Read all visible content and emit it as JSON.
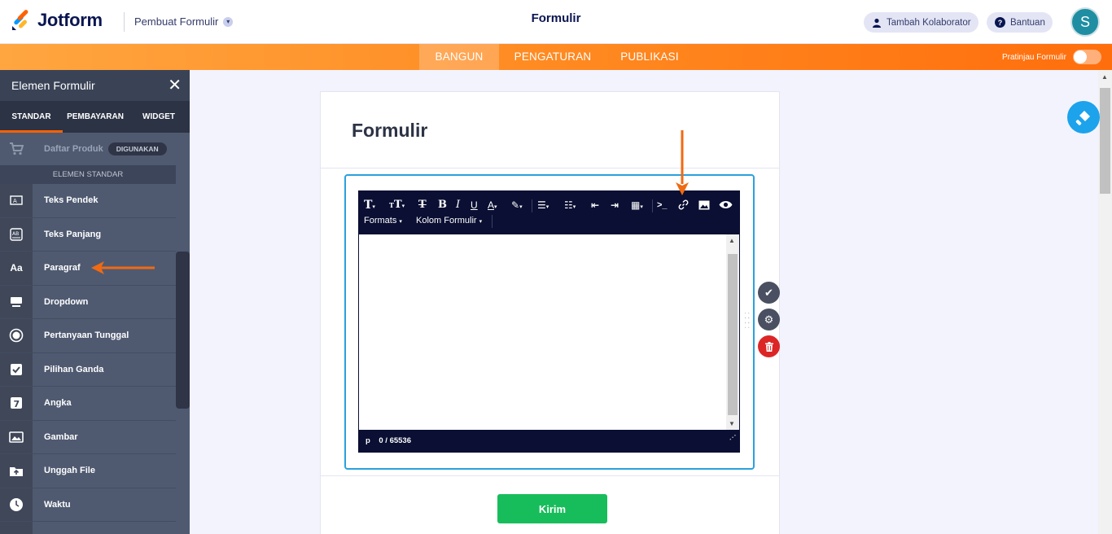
{
  "header": {
    "logo_text": "Jotform",
    "builder_menu": "Pembuat Formulir",
    "page_title": "Formulir",
    "collaborator_button": "Tambah Kolaborator",
    "help_button": "Bantuan",
    "avatar_initial": "S"
  },
  "nav": {
    "tabs": [
      "BANGUN",
      "PENGATURAN",
      "PUBLIKASI"
    ],
    "active_tab": "BANGUN",
    "preview_label": "Pratinjau Formulir"
  },
  "sidebar": {
    "title": "Elemen Formulir",
    "tabs": [
      "STANDAR",
      "PEMBAYARAN",
      "WIDGET"
    ],
    "product": {
      "label": "Daftar Produk",
      "badge": "DIGUNAKAN"
    },
    "section_label": "ELEMEN STANDAR",
    "items": [
      {
        "label": "Teks Pendek",
        "icon": "short-text-icon"
      },
      {
        "label": "Teks Panjang",
        "icon": "long-text-icon"
      },
      {
        "label": "Paragraf",
        "icon": "paragraph-icon"
      },
      {
        "label": "Dropdown",
        "icon": "dropdown-icon"
      },
      {
        "label": "Pertanyaan Tunggal",
        "icon": "radio-icon"
      },
      {
        "label": "Pilihan Ganda",
        "icon": "checkbox-icon"
      },
      {
        "label": "Angka",
        "icon": "number-icon"
      },
      {
        "label": "Gambar",
        "icon": "image-icon"
      },
      {
        "label": "Unggah File",
        "icon": "upload-icon"
      },
      {
        "label": "Waktu",
        "icon": "clock-icon"
      }
    ]
  },
  "form": {
    "title": "Formulir",
    "editor": {
      "formats_menu": "Formats",
      "fields_menu": "Kolom Formulir",
      "status_tag": "p",
      "char_count": "0 / 65536"
    },
    "submit_label": "Kirim"
  },
  "colors": {
    "brand_orange": "#ff6100",
    "navy": "#0a1551",
    "submit_green": "#18bd5b",
    "selection_blue": "#2aa1de",
    "annotation_arrow": "#f06a12"
  }
}
